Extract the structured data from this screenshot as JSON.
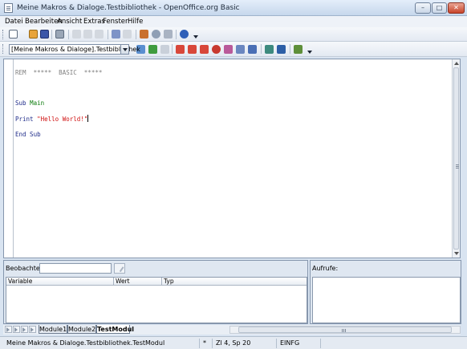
{
  "window": {
    "title": "Meine Makros & Dialoge.Testbibliothek - OpenOffice.org Basic",
    "minimize": "–",
    "maximize": "□",
    "close": "✕"
  },
  "menu": [
    "Datei",
    "Bearbeiten",
    "Ansicht",
    "Extras",
    "Fenster",
    "Hilfe"
  ],
  "toolbar": {
    "library_select": "[Meine Makros & Dialoge].Testbibliothek"
  },
  "editor": {
    "lines": [
      {
        "parts": [
          {
            "t": "REM  *****  BASIC  *****",
            "k": "comment"
          }
        ]
      },
      {
        "parts": [
          {
            "t": "",
            "k": "kw"
          }
        ]
      },
      {
        "parts": [
          {
            "t": "Sub ",
            "k": "kw"
          },
          {
            "t": "Main",
            "k": "id"
          }
        ]
      },
      {
        "parts": [
          {
            "t": "Print ",
            "k": "kw"
          },
          {
            "t": "\"Hello World!\"",
            "k": "str"
          }
        ]
      },
      {
        "parts": [
          {
            "t": "End Sub",
            "k": "kw"
          }
        ]
      }
    ]
  },
  "watch": {
    "label": "Beobachter:",
    "columns": [
      "Variable",
      "Wert",
      "Typ"
    ]
  },
  "calls": {
    "label": "Aufrufe:"
  },
  "tabs": [
    "Module1",
    "Module2",
    "TestModul"
  ],
  "status": {
    "document": "Meine Makros & Dialoge.Testbibliothek.TestModul",
    "modified": "*",
    "position": "Zl 4, Sp 20",
    "mode": "EINFG"
  },
  "colors": {
    "comment": "#808080",
    "keyword": "#1f2c8a",
    "identifier": "#0a7a0a",
    "string": "#d01010"
  },
  "icons": [
    "new-document-icon",
    "open-folder-icon",
    "save-icon",
    "print-icon",
    "cut-icon",
    "copy-icon",
    "paste-icon",
    "undo-icon",
    "redo-icon",
    "gallery-icon",
    "navigator-icon",
    "datasources-icon",
    "help-icon",
    "compile-icon",
    "run-icon",
    "stop-icon",
    "step-over-icon",
    "step-into-icon",
    "step-out-icon",
    "breakpoint-icon",
    "manage-breakpoints-icon",
    "add-watch-icon",
    "find-parentheses-icon",
    "object-catalog-icon",
    "macros-icon",
    "modules-icon",
    "import-dialog-icon"
  ]
}
